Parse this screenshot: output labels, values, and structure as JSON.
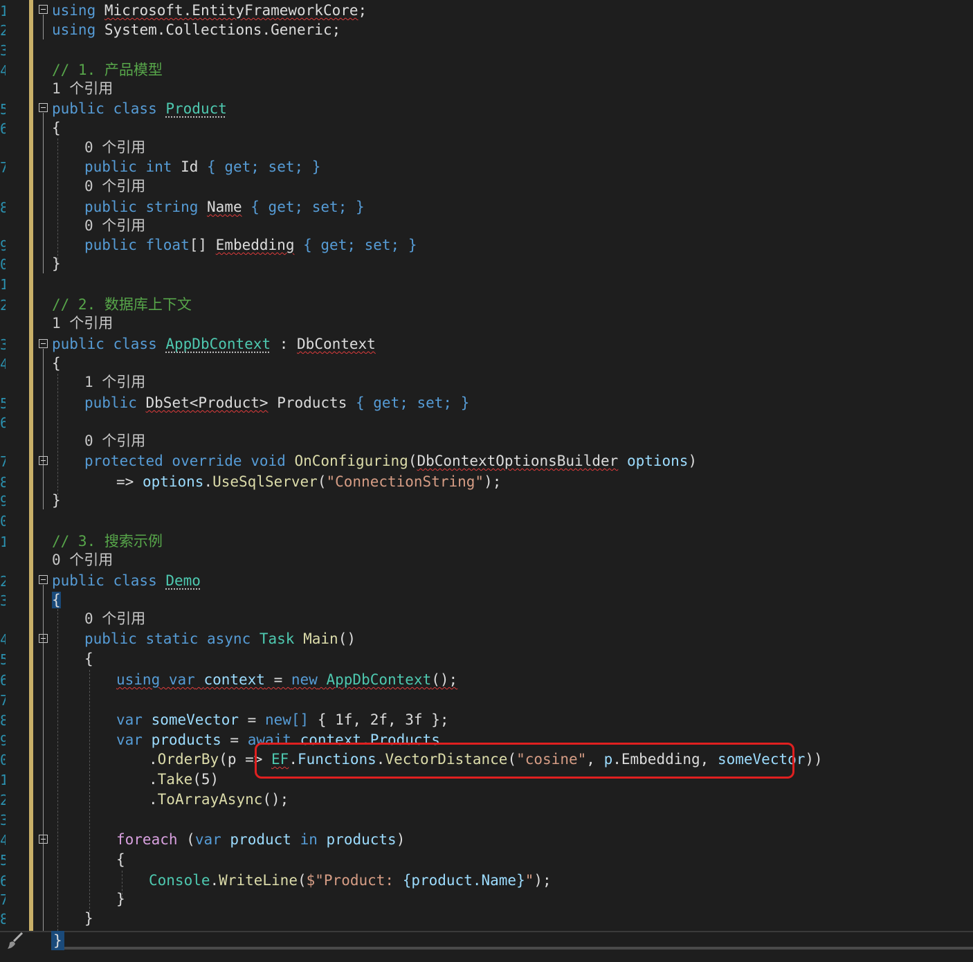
{
  "gutter_numbers": [
    "1",
    "2",
    "3",
    "4",
    "5",
    "6",
    "7",
    "8",
    "9",
    "0",
    "1",
    "2",
    "3",
    "4",
    "5",
    "6",
    "7",
    "8",
    "9",
    "0",
    "1",
    "2",
    "3",
    "4",
    "5",
    "6",
    "7",
    "8",
    "9",
    "0",
    "1",
    "2",
    "3",
    "4",
    "5",
    "6",
    "7",
    "8"
  ],
  "code": {
    "using1": {
      "kw": "using",
      "ns": "Microsoft.EntityFrameworkCore",
      "end": ";"
    },
    "using2": {
      "kw": "using",
      "ns": "System.Collections.Generic",
      "end": ";"
    },
    "comment1": "// 1. 产品模型",
    "ref_1_product": "1 个引用",
    "product_class": {
      "mods": "public class",
      "name": "Product"
    },
    "ref_0_id": "0 个引用",
    "prop_id": {
      "mods": "public int",
      "name": "Id",
      "acc": "{ get; set; }"
    },
    "ref_0_name": "0 个引用",
    "prop_name": {
      "mods": "public string",
      "name": "Name",
      "acc": "{ get; set; }"
    },
    "ref_0_emb": "0 个引用",
    "prop_emb": {
      "mods": "public float",
      "arr": "[]",
      "name": "Embedding",
      "acc": "{ get; set; }"
    },
    "comment2": "// 2. 数据库上下文",
    "ref_1_ctx": "1 个引用",
    "ctx_class": {
      "mods": "public class",
      "name": "AppDbContext",
      "colon": " : ",
      "base": "DbContext"
    },
    "ref_1_products": "1 个引用",
    "prop_products": {
      "mods": "public",
      "type": "DbSet<Product>",
      "name": "Products",
      "acc": "{ get; set; }"
    },
    "ref_0_onconf": "0 个引用",
    "onconf": {
      "mods": "protected override void",
      "name": "OnConfiguring",
      "open": "(",
      "ptype": "DbContextOptionsBuilder",
      "pname": "options",
      "close": ")"
    },
    "onconf_body": {
      "arrow": "=> ",
      "obj": "options",
      "dot": ".",
      "method": "UseSqlServer",
      "open": "(",
      "str": "\"ConnectionString\"",
      "close": ");"
    },
    "comment3": "// 3. 搜索示例",
    "ref_0_demo": "0 个引用",
    "demo_class": {
      "mods": "public class",
      "name": "Demo"
    },
    "ref_0_main": "0 个引用",
    "main_sig": {
      "mods": "public static async",
      "type": "Task",
      "name": "Main",
      "parens": "()"
    },
    "using_var": {
      "kw": "using var",
      "name": "context",
      "eq": " = ",
      "new": "new",
      "type": "AppDbContext",
      "end": "();"
    },
    "some_vector": {
      "kw": "var",
      "name": "someVector",
      "eq": " = ",
      "new": "new[]",
      "vals": " { 1f, 2f, 3f };"
    },
    "products_var": {
      "kw": "var",
      "name": "products",
      "eq": " = ",
      "await": "await",
      "rest": "context.Products"
    },
    "orderby": {
      "dot": ".",
      "method": "OrderBy",
      "lambda": "(p => "
    },
    "ef_call": {
      "ef": "EF",
      "dot1": ".",
      "functions": "Functions",
      "dot2": ".",
      "method": "VectorDistance",
      "open": "(",
      "str": "\"cosine\"",
      "sep1": ", ",
      "p": "p",
      "dot3": ".",
      "emb": "Embedding",
      "sep2": ", ",
      "sv": "someVector",
      "close": "))"
    },
    "take": {
      "dot": ".",
      "method": "Take",
      "args": "(5)"
    },
    "toarray": {
      "dot": ".",
      "method": "ToArrayAsync",
      "args": "();"
    },
    "foreach": {
      "kw": "foreach",
      "open": " (",
      "var": "var",
      "name": "product",
      "in": "in",
      "coll": "products",
      "close": ")"
    },
    "writeline": {
      "type": "Console",
      "dot": ".",
      "method": "WriteLine",
      "open": "(",
      "str_a": "$\"Product: ",
      "interp": "{product.Name}",
      "str_b": "\"",
      "close": ");"
    },
    "brace_open": "{",
    "brace_close": "}"
  }
}
